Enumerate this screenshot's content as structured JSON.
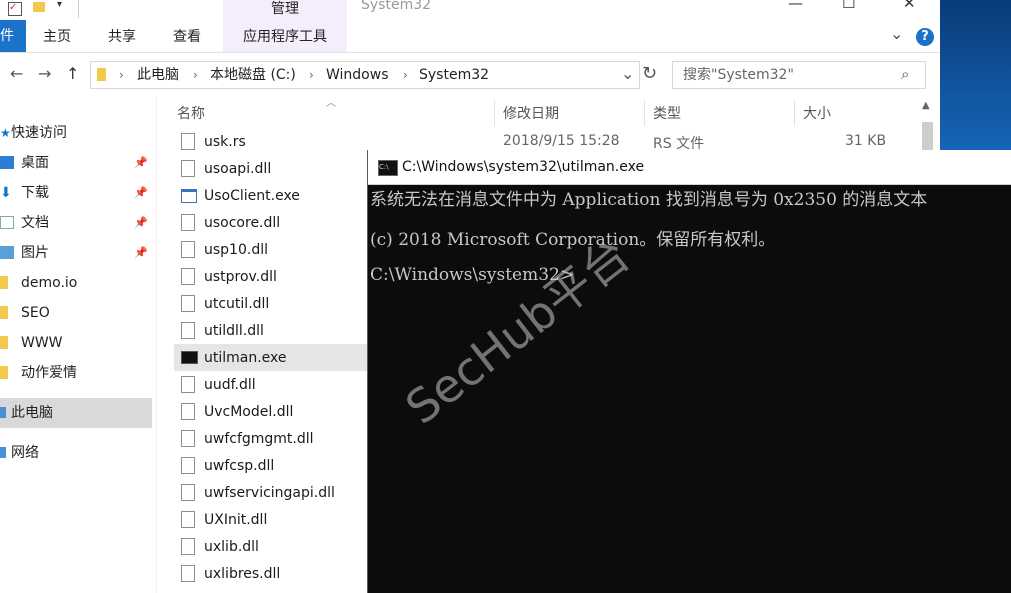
{
  "window": {
    "title": "System32",
    "manage_tab": "管理",
    "controls": {
      "minimize": "—",
      "maximize": "☐",
      "close": "✕"
    }
  },
  "ribbon": {
    "file_tab": "件",
    "tabs": [
      "主页",
      "共享",
      "查看"
    ],
    "app_tools_tab": "应用程序工具",
    "expand": "⌄",
    "help": "?"
  },
  "nav": {
    "back": "←",
    "forward": "→",
    "up": "↑",
    "address_dropdown": "⌄",
    "breadcrumb": [
      "此电脑",
      "本地磁盘 (C:)",
      "Windows",
      "System32"
    ],
    "search_placeholder": "搜索\"System32\""
  },
  "sidebar": {
    "items": [
      {
        "label": "快速访问",
        "pinned": false
      },
      {
        "label": "桌面",
        "pinned": true
      },
      {
        "label": "下载",
        "pinned": true
      },
      {
        "label": "文档",
        "pinned": true
      },
      {
        "label": "图片",
        "pinned": true
      },
      {
        "label": "demo.io",
        "pinned": false
      },
      {
        "label": "SEO",
        "pinned": false
      },
      {
        "label": "WWW",
        "pinned": false
      },
      {
        "label": "动作爱情",
        "pinned": false
      },
      {
        "label": "此电脑",
        "pinned": false
      },
      {
        "label": "网络",
        "pinned": false
      }
    ]
  },
  "list": {
    "columns": [
      "名称",
      "修改日期",
      "类型",
      "大小"
    ],
    "first_row": {
      "date": "2018/9/15 15:28",
      "type": "RS 文件",
      "size": "31 KB"
    },
    "files": [
      "usk.rs",
      "usoapi.dll",
      "UsoClient.exe",
      "usocore.dll",
      "usp10.dll",
      "ustprov.dll",
      "utcutil.dll",
      "utildll.dll",
      "utilman.exe",
      "uudf.dll",
      "UvcModel.dll",
      "uwfcfgmgmt.dll",
      "uwfcsp.dll",
      "uwfservicingapi.dll",
      "UXInit.dll",
      "uxlib.dll",
      "uxlibres.dll"
    ],
    "selected": "utilman.exe"
  },
  "console": {
    "title": "C:\\Windows\\system32\\utilman.exe",
    "lines": [
      "系统无法在消息文件中为 Application 找到消息号为 0x2350 的消息文本",
      "(c) 2018 Microsoft Corporation。保留所有权利。",
      "C:\\Windows\\system32>"
    ]
  },
  "watermark": "SecHub平台",
  "colors": {
    "accent": "#1a73c9",
    "manage_bg": "#f4eefc",
    "console_bg": "#0c0c0c"
  }
}
